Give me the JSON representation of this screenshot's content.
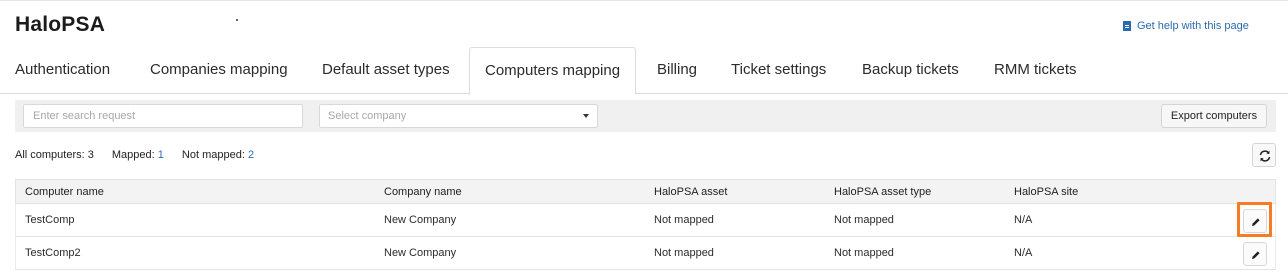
{
  "header": {
    "title": "HaloPSA",
    "help_link": "Get help with this page"
  },
  "tabs": [
    {
      "label": "Authentication",
      "active": false
    },
    {
      "label": "Companies mapping",
      "active": false
    },
    {
      "label": "Default asset types",
      "active": false
    },
    {
      "label": "Computers mapping",
      "active": true
    },
    {
      "label": "Billing",
      "active": false
    },
    {
      "label": "Ticket settings",
      "active": false
    },
    {
      "label": "Backup tickets",
      "active": false
    },
    {
      "label": "RMM tickets",
      "active": false
    }
  ],
  "toolbar": {
    "search_placeholder": "Enter search request",
    "company_select": "Select company",
    "export_label": "Export computers"
  },
  "stats": {
    "all_label": "All computers:",
    "all_value": "3",
    "mapped_label": "Mapped:",
    "mapped_value": "1",
    "not_mapped_label": "Not mapped:",
    "not_mapped_value": "2"
  },
  "table": {
    "columns": [
      "Computer name",
      "Company name",
      "HaloPSA asset",
      "HaloPSA asset type",
      "HaloPSA site"
    ],
    "rows": [
      [
        "TestComp",
        "New Company",
        "Not mapped",
        "Not mapped",
        "N/A"
      ],
      [
        "TestComp2",
        "New Company",
        "Not mapped",
        "Not mapped",
        "N/A"
      ]
    ]
  },
  "colors": {
    "accent": "#2a6ab0",
    "highlight": "#f57c22"
  }
}
